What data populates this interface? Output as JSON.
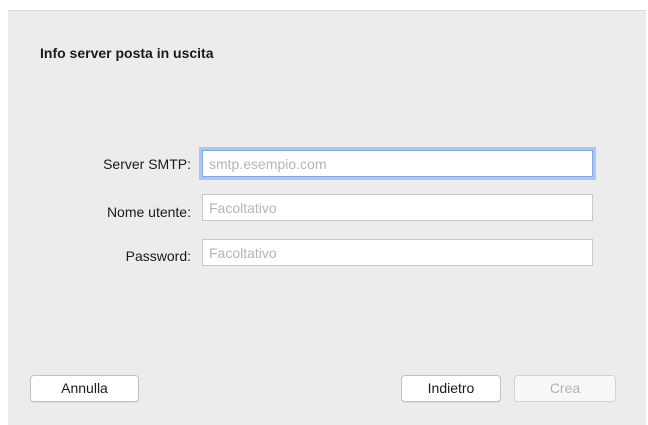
{
  "dialog": {
    "title": "Info server posta in uscita"
  },
  "form": {
    "smtp_server": {
      "label": "Server SMTP:",
      "value": "",
      "placeholder": "smtp.esempio.com"
    },
    "username": {
      "label": "Nome utente:",
      "value": "",
      "placeholder": "Facoltativo"
    },
    "password": {
      "label": "Password:",
      "value": "",
      "placeholder": "Facoltativo"
    }
  },
  "buttons": {
    "cancel": "Annulla",
    "back": "Indietro",
    "create": "Crea"
  },
  "state": {
    "focused_field": "smtp_server",
    "create_enabled": false
  },
  "colors": {
    "focus_ring": "#a9c7f2",
    "sheet_background": "#ececec"
  }
}
